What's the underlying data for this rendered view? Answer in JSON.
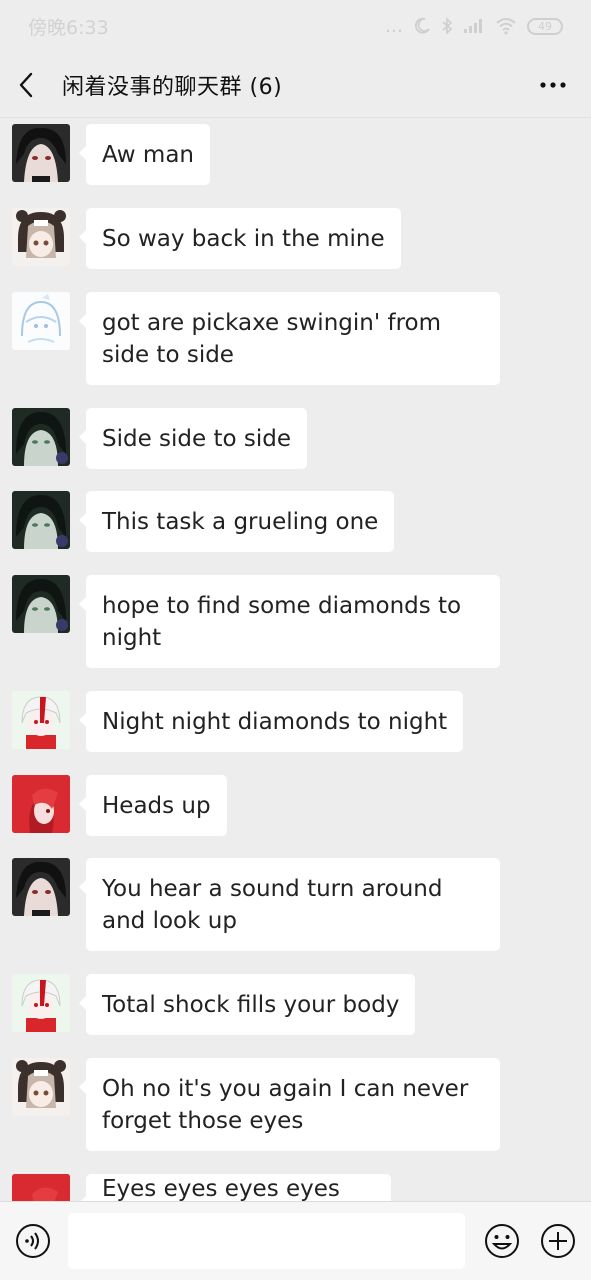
{
  "status_bar": {
    "time": "傍晚6:33",
    "battery": "49",
    "dots": "..."
  },
  "header": {
    "title": "闲着没事的聊天群 (6)"
  },
  "messages": [
    {
      "avatar": "avatar-dark-hair-red-eyes",
      "text": "Aw man"
    },
    {
      "avatar": "avatar-bear-hood-girl",
      "text": "So way back in the mine"
    },
    {
      "avatar": "avatar-light-blue-sketch",
      "text": "got are pickaxe swingin' from side to side"
    },
    {
      "avatar": "avatar-dark-green-hair",
      "text": "Side side to side"
    },
    {
      "avatar": "avatar-dark-green-hair",
      "text": "This task a grueling one"
    },
    {
      "avatar": "avatar-dark-green-hair",
      "text": "hope to find some diamonds to night"
    },
    {
      "avatar": "avatar-red-white-hair",
      "text": "Night night diamonds to night"
    },
    {
      "avatar": "avatar-red-hair",
      "text": "Heads up"
    },
    {
      "avatar": "avatar-dark-hair-red-eyes",
      "text": "You hear a sound turn around and look up"
    },
    {
      "avatar": "avatar-red-white-hair",
      "text": "Total shock fills your body"
    },
    {
      "avatar": "avatar-bear-hood-girl",
      "text": "Oh no it's you again I can never forget those eyes"
    },
    {
      "avatar": "avatar-red-hair",
      "text": "Eyes eyes eyes eyes eyes"
    }
  ],
  "input": {
    "placeholder": ""
  },
  "colors": {
    "background": "#ededed",
    "bubble": "#ffffff",
    "text": "#222222"
  }
}
